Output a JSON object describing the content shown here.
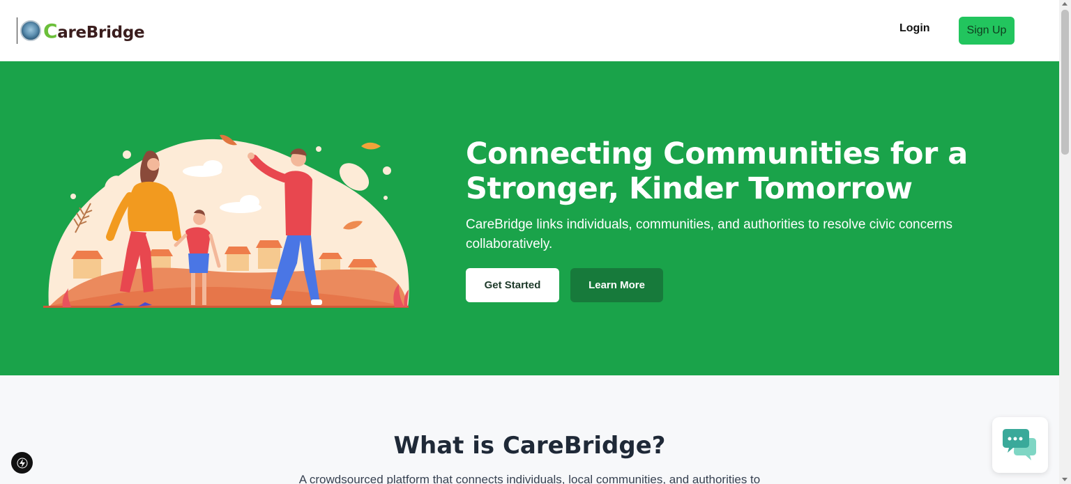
{
  "header": {
    "brand_initial": "C",
    "brand_rest": "areBridge",
    "login_label": "Login",
    "signup_label": "Sign Up"
  },
  "hero": {
    "title": "Connecting Communities for a Stronger, Kinder Tomorrow",
    "subtitle": "CareBridge links individuals, communities, and authorities to resolve civic concerns collaboratively.",
    "get_started_label": "Get Started",
    "learn_more_label": "Learn More"
  },
  "about": {
    "title": "What is CareBridge?",
    "text": "A crowdsourced platform that connects individuals, local communities, and authorities to"
  },
  "colors": {
    "brand_green": "#1aa34a",
    "signup_green": "#22c55e",
    "learn_more_green": "#177a3b"
  },
  "icons": {
    "chat": "chat-bubbles-icon",
    "dev": "lightning-icon",
    "logo": "carebridge-logo-icon"
  }
}
